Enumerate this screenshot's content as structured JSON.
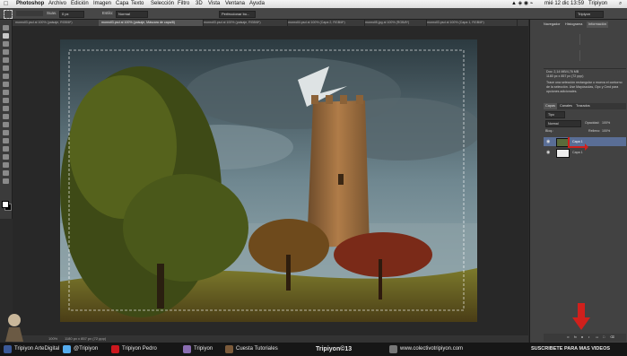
{
  "menubar": {
    "apple": "",
    "app": "Photoshop",
    "menus": [
      "Archivo",
      "Edición",
      "Imagen",
      "Capa",
      "Texto",
      "Selección",
      "Filtro",
      "3D",
      "Vista",
      "Ventana",
      "Ayuda"
    ],
    "clock": "mié 12 dic  13:59",
    "user": "Tripiyon"
  },
  "options": {
    "suavizar_label": "Suav.",
    "suavizar_value": "0 px",
    "estilo_label": "Estilo:",
    "estilo_value": "Normal",
    "refine_button": "Perfeccionar bo...",
    "workspace": "Tripiyon"
  },
  "tabs": [
    "monroll3.psd al 100% (paisaje, RGB/8*)",
    "monroll3.psd al 100% (paisaje, Máscara de capa/8)",
    "monroll3.psd al 100% (paisaje, RGB/8*)",
    "monroll4.psd al 100% (Capa 2, RGB/8*)",
    "monroll5.jpg al 100% (RGB/8*)",
    "monroll3.psd al 100% (Capa 1, RGB/8*)"
  ],
  "statusbar": {
    "size": "1180 px x 857 px (72 ppp)"
  },
  "panels": {
    "top_tabs": [
      "Navegador",
      "Histograma",
      "Información"
    ],
    "info_lines": [
      "Doc: 2,14 MB/4,76 MB",
      "1180 px x 857 px (72 ppp)"
    ],
    "info_desc": "Trace una selección rectangular o mueva el contorno de la selección. Use Mayúsculas, Opc y Cmd para opciones adicionales.",
    "layers_tabs": [
      "Capas",
      "Canales",
      "Trazados"
    ],
    "kind": "Tipo",
    "blend": "Normal",
    "opacity_label": "Opacidad:",
    "opacity_value": "100%",
    "lock_label": "Bloq.:",
    "fill_label": "Relleno:",
    "fill_value": "100%",
    "layers": [
      {
        "name": "Capa 1",
        "selected": true
      },
      {
        "name": "Capa 1",
        "selected": false
      }
    ]
  },
  "social": {
    "facebook": "Tripiyon ArteDigital",
    "twitter": "@Tripiyon",
    "youtube": "Tripiyon Pedro",
    "blog": "Tripiyon",
    "ct": "Cuesta Tutoriales",
    "center": "Tripiyon©13",
    "site": "www.colectivotripiyon.com",
    "subscribe": "SUSCRIBETE PARA MAS VIDEOS"
  },
  "colors": {
    "accent_red": "#d0201c",
    "selected_layer": "#5a6e96"
  }
}
